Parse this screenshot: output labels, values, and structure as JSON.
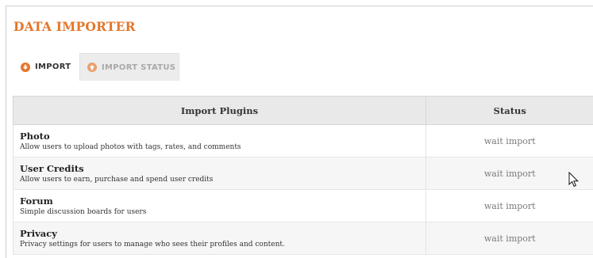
{
  "page": {
    "title": "DATA IMPORTER"
  },
  "tabs": [
    {
      "label": "IMPORT",
      "icon": "arrow-down-circle-icon",
      "active": false
    },
    {
      "label": "IMPORT STATUS",
      "icon": "arrow-up-circle-icon",
      "active": true
    }
  ],
  "table": {
    "headers": {
      "plugin": "Import Plugins",
      "status": "Status"
    },
    "rows": [
      {
        "name": "Photo",
        "description": "Allow users to upload photos with tags, rates, and comments",
        "status": "wait import"
      },
      {
        "name": "User Credits",
        "description": "Allow users to earn, purchase and spend user credits",
        "status": "wait import"
      },
      {
        "name": "Forum",
        "description": "Simple discussion boards for users",
        "status": "wait import"
      },
      {
        "name": "Privacy",
        "description": "Privacy settings for users to manage who sees their profiles and content.",
        "status": "wait import"
      }
    ]
  },
  "colors": {
    "accent": "#e4762b",
    "accent_light": "#e9a06f",
    "header_bg": "#e9e9e9",
    "tab_active_bg": "#ececec"
  }
}
